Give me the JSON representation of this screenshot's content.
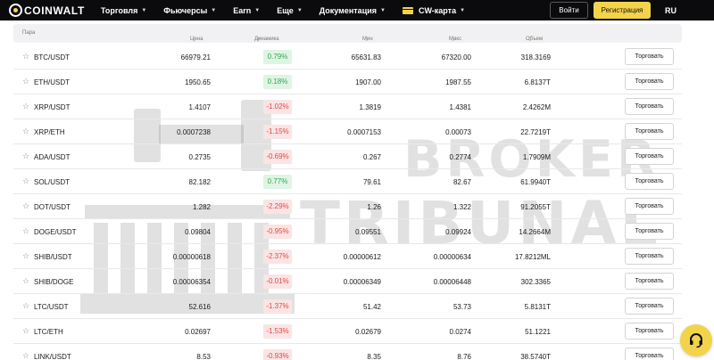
{
  "brand": {
    "name": "COINWALT"
  },
  "nav": {
    "items": [
      {
        "label": "Торговля"
      },
      {
        "label": "Фьючерсы"
      },
      {
        "label": "Earn"
      },
      {
        "label": "Еще"
      },
      {
        "label": "Документация"
      }
    ],
    "card_label": "CW-карта"
  },
  "auth": {
    "login_label": "Войти",
    "register_label": "Регистрация",
    "language": "RU"
  },
  "table": {
    "headers": {
      "pair": "Пара",
      "price": "Цена",
      "change": "Динамика",
      "min": "Мин",
      "max": "Макс",
      "volume": "Объем"
    },
    "trade_label": "Торговать",
    "rows": [
      {
        "pair": "BTC/USDT",
        "price": "66979.21",
        "change": "0.79%",
        "dir": "up",
        "min": "65631.83",
        "max": "67320.00",
        "volume": "318.3169"
      },
      {
        "pair": "ETH/USDT",
        "price": "1950.65",
        "change": "0.18%",
        "dir": "up",
        "min": "1907.00",
        "max": "1987.55",
        "volume": "6.8137T"
      },
      {
        "pair": "XRP/USDT",
        "price": "1.4107",
        "change": "-1.02%",
        "dir": "down",
        "min": "1.3819",
        "max": "1.4381",
        "volume": "2.4262M"
      },
      {
        "pair": "XRP/ETH",
        "price": "0.0007238",
        "change": "-1.15%",
        "dir": "down",
        "min": "0.0007153",
        "max": "0.00073",
        "volume": "22.7219T"
      },
      {
        "pair": "ADA/USDT",
        "price": "0.2735",
        "change": "-0.69%",
        "dir": "down",
        "min": "0.267",
        "max": "0.2774",
        "volume": "1.7909M"
      },
      {
        "pair": "SOL/USDT",
        "price": "82.182",
        "change": "0.77%",
        "dir": "up",
        "min": "79.61",
        "max": "82.67",
        "volume": "61.9940T"
      },
      {
        "pair": "DOT/USDT",
        "price": "1.282",
        "change": "-2.29%",
        "dir": "down",
        "min": "1.26",
        "max": "1.322",
        "volume": "91.2055T"
      },
      {
        "pair": "DOGE/USDT",
        "price": "0.09804",
        "change": "-0.95%",
        "dir": "down",
        "min": "0.09551",
        "max": "0.09924",
        "volume": "14.2664M"
      },
      {
        "pair": "SHIB/USDT",
        "price": "0.00000618",
        "change": "-2.37%",
        "dir": "down",
        "min": "0.00000612",
        "max": "0.00000634",
        "volume": "17.8212ML"
      },
      {
        "pair": "SHIB/DOGE",
        "price": "0.00006354",
        "change": "-0.01%",
        "dir": "down",
        "min": "0.00006349",
        "max": "0.00006448",
        "volume": "302.3365"
      },
      {
        "pair": "LTC/USDT",
        "price": "52.616",
        "change": "-1.37%",
        "dir": "down",
        "min": "51.42",
        "max": "53.73",
        "volume": "5.8131T"
      },
      {
        "pair": "LTC/ETH",
        "price": "0.02697",
        "change": "-1.53%",
        "dir": "down",
        "min": "0.02679",
        "max": "0.0274",
        "volume": "51.1221"
      },
      {
        "pair": "LINK/USDT",
        "price": "8.53",
        "change": "-0.93%",
        "dir": "down",
        "min": "8.35",
        "max": "8.76",
        "volume": "38.5740T"
      }
    ]
  },
  "watermark": {
    "line1": "BROKER",
    "line2": "TRIBUNAL"
  },
  "colors": {
    "accent": "#f3d34a",
    "up": "#31a952",
    "down": "#e04a4a",
    "header_bg": "#0b0b0d"
  },
  "icons": {
    "star": "star-icon",
    "chat": "chat-icon",
    "logo": "coinwalt-logo-icon",
    "card": "card-icon",
    "sort": "sort-icon",
    "chevron": "chevron-down-icon"
  }
}
